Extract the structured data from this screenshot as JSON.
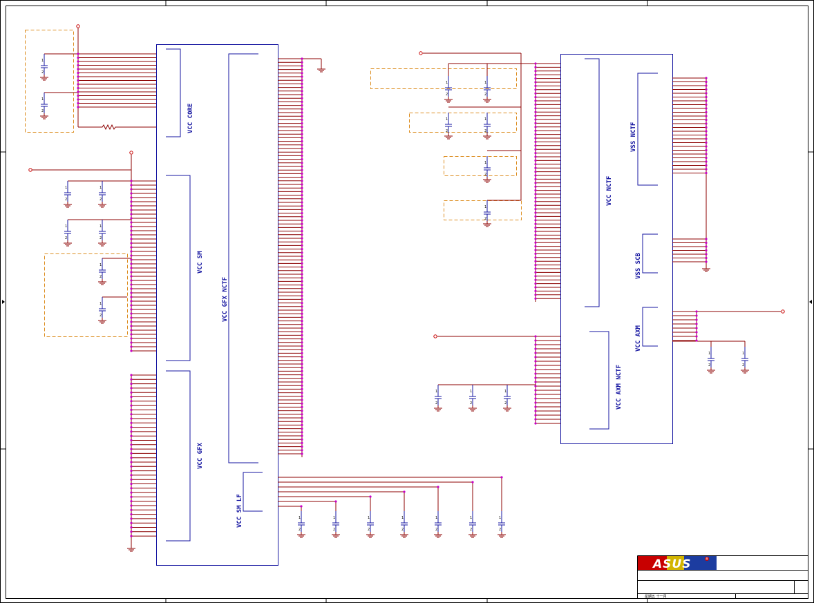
{
  "blocks": {
    "vcc_core": "VCC CORE",
    "vcc_sm": "VCC SM",
    "vcc_gfx_nctf": "VCC GFX NCTF",
    "vcc_gfx": "VCC GFX",
    "vcc_sm_lf": "VCC SM LF",
    "vcc_nctf": "VCC NCTF",
    "vss_nctf": "VSS NCTF",
    "vss_scb": "VSS SCB",
    "vcc_axm": "VCC AXM",
    "vcc_axm_nctf": "VCC AXM NCTF"
  },
  "title_block": {
    "logo": "ASUS",
    "registered": "®",
    "date_label": "星期五 十一月"
  },
  "colors": {
    "frame": "#000000",
    "component": "#1414a0",
    "wire": "#8c0000",
    "junction": "#c800c8",
    "net_port": "#c80000",
    "group_box": "#dc8c1e"
  }
}
